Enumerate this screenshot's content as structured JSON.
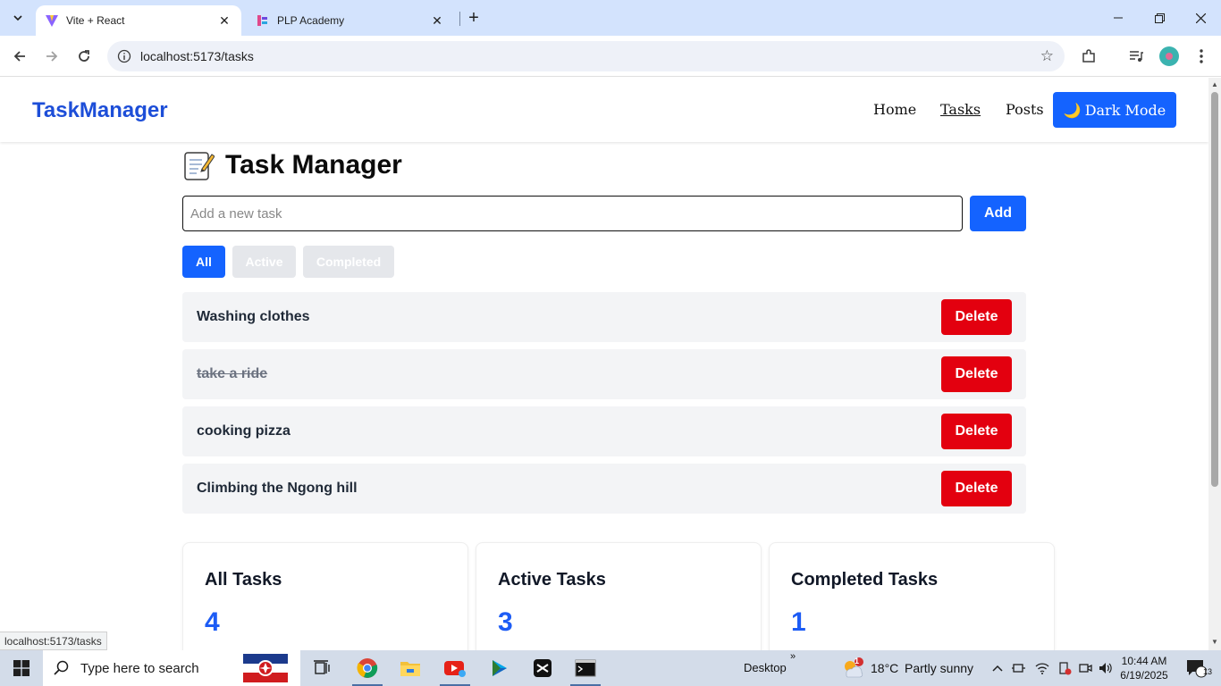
{
  "browser": {
    "tabs": [
      {
        "title": "Vite + React",
        "active": true
      },
      {
        "title": "PLP Academy",
        "active": false
      }
    ],
    "url": "localhost:5173/tasks",
    "status_url": "localhost:5173/tasks"
  },
  "app": {
    "brand": "TaskManager",
    "nav": {
      "home": "Home",
      "tasks": "Tasks",
      "posts": "Posts"
    },
    "dark_mode": {
      "icon": "🌙",
      "label": "Dark Mode"
    },
    "heading": "Task Manager",
    "input": {
      "placeholder": "Add a new task",
      "value": ""
    },
    "add_label": "Add",
    "filters": {
      "all": "All",
      "active": "Active",
      "completed": "Completed",
      "selected": "All"
    },
    "tasks": [
      {
        "text": "Washing clothes",
        "completed": false
      },
      {
        "text": "take a ride",
        "completed": true
      },
      {
        "text": "cooking pizza",
        "completed": false
      },
      {
        "text": "Climbing the Ngong hill",
        "completed": false
      }
    ],
    "delete_label": "Delete",
    "stats": [
      {
        "title": "All Tasks",
        "value": "4"
      },
      {
        "title": "Active Tasks",
        "value": "3"
      },
      {
        "title": "Completed Tasks",
        "value": "1"
      }
    ]
  },
  "taskbar": {
    "search_placeholder": "Type here to search",
    "desktop_label": "Desktop",
    "weather": {
      "temp": "18°C",
      "condition": "Partly sunny",
      "badge": "1"
    },
    "time": "10:44 AM",
    "date": "6/19/2025",
    "notifications": "13"
  },
  "colors": {
    "accent": "#1463ff",
    "brand": "#1d4ed8",
    "danger": "#e3000f",
    "chrome_tabstrip": "#d3e3fd"
  }
}
